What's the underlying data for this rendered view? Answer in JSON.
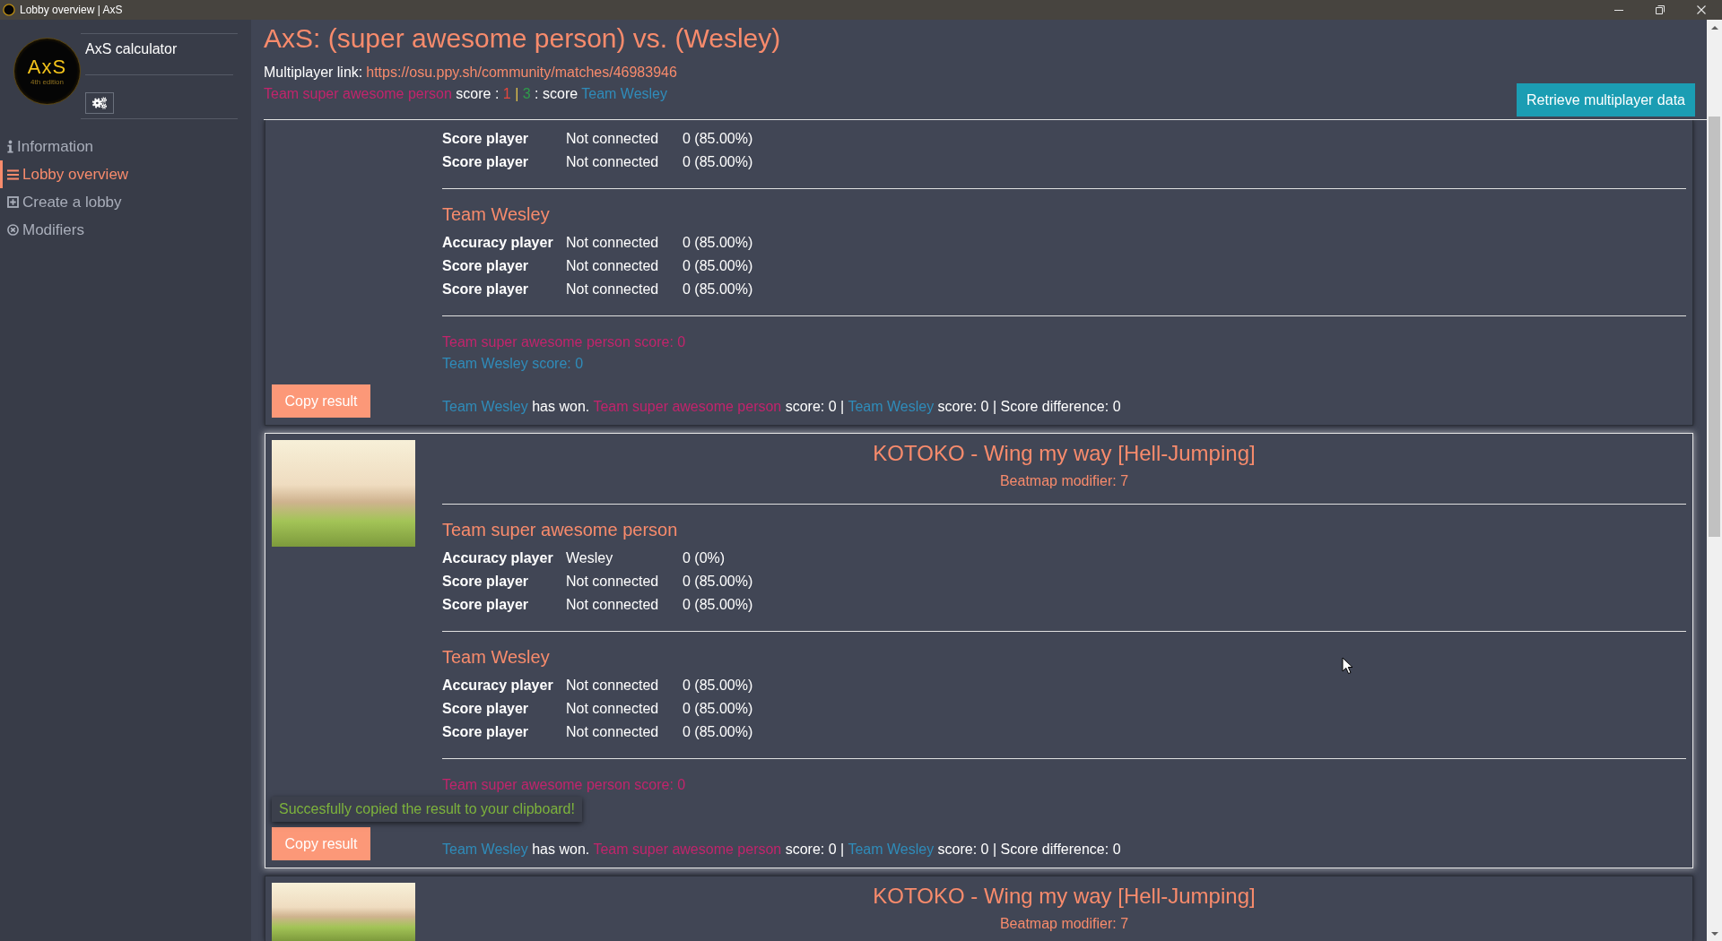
{
  "window": {
    "title": "Lobby overview | AxS"
  },
  "sidebar": {
    "logo": {
      "title": "AxS",
      "subtitle": "4th edition"
    },
    "app_name": "AxS calculator",
    "nav_items": [
      {
        "label": "Information",
        "selected": false
      },
      {
        "label": "Lobby overview",
        "selected": true
      },
      {
        "label": "Create a lobby",
        "selected": false
      },
      {
        "label": "Modifiers",
        "selected": false
      }
    ]
  },
  "header": {
    "title": "AxS: (super awesome person) vs. (Wesley)",
    "link_label": "Multiplayer link:",
    "link": "https://osu.ppy.sh/community/matches/46983946",
    "score_line": [
      {
        "text": "Team super awesome person",
        "color": "#c2246c"
      },
      {
        "text": " score : "
      },
      {
        "text": "1",
        "color": "#e5463c"
      },
      {
        "text": " | ",
        "color": "#e3c34a"
      },
      {
        "text": "3",
        "color": "#2f9a4a"
      },
      {
        "text": " : score "
      },
      {
        "text": "Team Wesley",
        "color": "#2f8cba"
      }
    ],
    "retrieve_button": "Retrieve multiplayer data"
  },
  "maps": [
    {
      "selected": false,
      "teams": [
        {
          "players": [
            {
              "role": "Score player",
              "name": "Not connected",
              "score": "0 (85.00%)"
            },
            {
              "role": "Score player",
              "name": "Not connected",
              "score": "0 (85.00%)"
            }
          ]
        },
        {
          "name": "Team Wesley",
          "players": [
            {
              "role": "Accuracy player",
              "name": "Not connected",
              "score": "0 (85.00%)"
            },
            {
              "role": "Score player",
              "name": "Not connected",
              "score": "0 (85.00%)"
            },
            {
              "role": "Score player",
              "name": "Not connected",
              "score": "0 (85.00%)"
            }
          ]
        }
      ],
      "team_scores": [
        {
          "text": "Team super awesome person score: 0",
          "color": "#c2246c"
        },
        {
          "text": "Team Wesley score: 0",
          "color": "#2f8cba"
        }
      ],
      "result": [
        {
          "text": "Team Wesley",
          "color": "#2f8cba"
        },
        {
          "text": " has won. "
        },
        {
          "text": "Team super awesome person",
          "color": "#c2246c"
        },
        {
          "text": " score: 0 | "
        },
        {
          "text": "Team Wesley",
          "color": "#2f8cba"
        },
        {
          "text": " score: 0 | Score difference: 0"
        }
      ],
      "copy_button": "Copy result"
    },
    {
      "selected": true,
      "title": "KOTOKO - Wing my way [Hell-Jumping]",
      "modifier": "Beatmap modifier: 7",
      "teams": [
        {
          "name": "Team super awesome person",
          "players": [
            {
              "role": "Accuracy player",
              "name": "Wesley",
              "score": "0 (0%)"
            },
            {
              "role": "Score player",
              "name": "Not connected",
              "score": "0 (85.00%)"
            },
            {
              "role": "Score player",
              "name": "Not connected",
              "score": "0 (85.00%)"
            }
          ]
        },
        {
          "name": "Team Wesley",
          "players": [
            {
              "role": "Accuracy player",
              "name": "Not connected",
              "score": "0 (85.00%)"
            },
            {
              "role": "Score player",
              "name": "Not connected",
              "score": "0 (85.00%)"
            },
            {
              "role": "Score player",
              "name": "Not connected",
              "score": "0 (85.00%)"
            }
          ]
        }
      ],
      "team_scores": [
        {
          "text": "Team super awesome person score: 0",
          "color": "#c2246c"
        }
      ],
      "toast": "Succesfully copied the result to your clipboard!",
      "result": [
        {
          "text": "Team Wesley",
          "color": "#2f8cba"
        },
        {
          "text": " has won. "
        },
        {
          "text": "Team super awesome person",
          "color": "#c2246c"
        },
        {
          "text": " score: 0 | "
        },
        {
          "text": "Team Wesley",
          "color": "#2f8cba"
        },
        {
          "text": " score: 0 | Score difference: 0"
        }
      ],
      "copy_button": "Copy result"
    },
    {
      "selected": false,
      "title": "KOTOKO - Wing my way [Hell-Jumping]",
      "modifier": "Beatmap modifier: 7"
    }
  ]
}
